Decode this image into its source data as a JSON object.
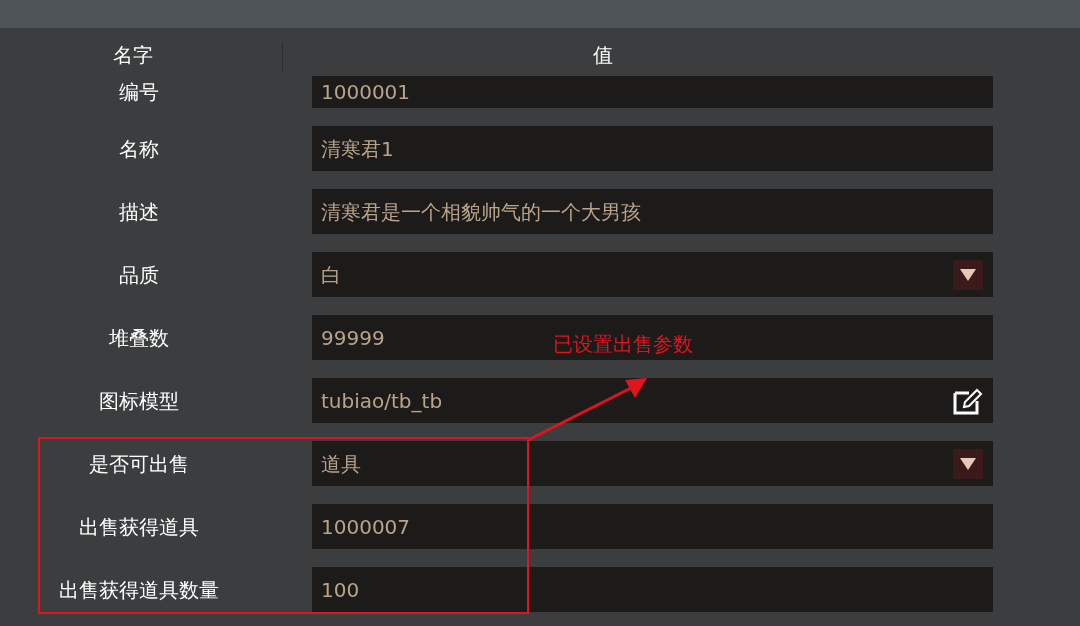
{
  "header": {
    "name_column": "名字",
    "value_column": "值"
  },
  "rows": [
    {
      "label": "编号",
      "value": "1000001",
      "kind": "text"
    },
    {
      "label": "名称",
      "value": "清寒君1",
      "kind": "text"
    },
    {
      "label": "描述",
      "value": "清寒君是一个相貌帅气的一个大男孩",
      "kind": "text"
    },
    {
      "label": "品质",
      "value": "白",
      "kind": "dropdown"
    },
    {
      "label": "堆叠数",
      "value": "99999",
      "kind": "text"
    },
    {
      "label": "图标模型",
      "value": "tubiao/tb_tb",
      "kind": "path"
    },
    {
      "label": "是否可出售",
      "value": "道具",
      "kind": "dropdown"
    },
    {
      "label": "出售获得道具",
      "value": "1000007",
      "kind": "text"
    },
    {
      "label": "出售获得道具数量",
      "value": "100",
      "kind": "text"
    }
  ],
  "annotation": {
    "text": "已设置出售参数"
  }
}
